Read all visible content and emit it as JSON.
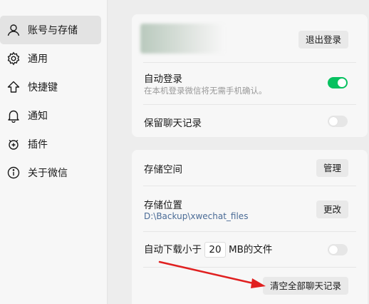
{
  "sidebar": {
    "items": [
      {
        "label": "账号与存储",
        "icon": "person-icon"
      },
      {
        "label": "通用",
        "icon": "gear-icon"
      },
      {
        "label": "快捷键",
        "icon": "arrow-up-icon"
      },
      {
        "label": "通知",
        "icon": "bell-icon"
      },
      {
        "label": "插件",
        "icon": "plugin-icon"
      },
      {
        "label": "关于微信",
        "icon": "info-icon"
      }
    ],
    "active_index": 0
  },
  "account_card": {
    "logout_label": "退出登录",
    "auto_login": {
      "label": "自动登录",
      "description": "在本机登录微信将无需手机确认。",
      "enabled": true
    },
    "keep_history": {
      "label": "保留聊天记录",
      "enabled": false
    }
  },
  "storage_card": {
    "storage_space": {
      "label": "存储空间",
      "button": "管理"
    },
    "storage_location": {
      "label": "存储位置",
      "path": "D:\\Backup\\xwechat_files",
      "button": "更改"
    },
    "auto_download": {
      "prefix": "自动下载小于",
      "value": "20",
      "suffix": "MB的文件",
      "enabled": false
    },
    "clear_button": "清空全部聊天记录"
  },
  "colors": {
    "accent": "#07c160",
    "arrow": "#e02020",
    "path_text": "#4a6b96"
  }
}
